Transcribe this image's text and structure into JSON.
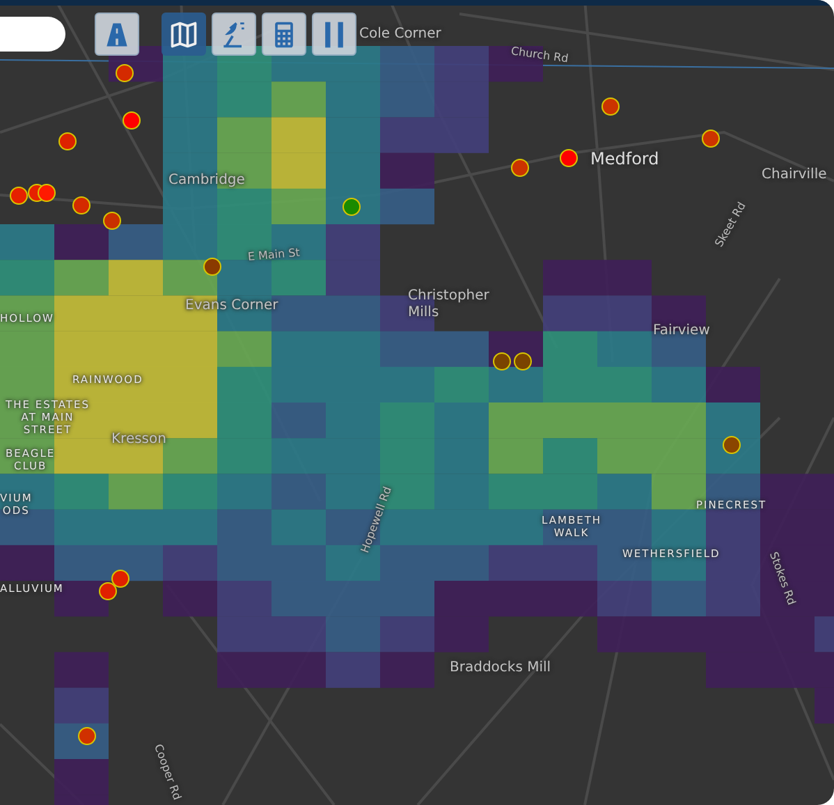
{
  "tools": [
    {
      "kind": "road",
      "selected": false
    },
    {
      "kind": "map",
      "selected": true
    },
    {
      "kind": "satellite",
      "selected": false
    },
    {
      "kind": "calculator",
      "selected": false
    },
    {
      "kind": "pause",
      "selected": false
    }
  ],
  "map_labels": [
    {
      "text": "Church Rd",
      "kind": "road"
    },
    {
      "text": "Cole Corner",
      "kind": "town"
    },
    {
      "text": "Medford",
      "kind": "city"
    },
    {
      "text": "Chairville",
      "kind": "town"
    },
    {
      "text": "Skeet Rd",
      "kind": "road"
    },
    {
      "text": "Cambridge",
      "kind": "town"
    },
    {
      "text": "E Main St",
      "kind": "road"
    },
    {
      "text": "Evans Corner",
      "kind": "town"
    },
    {
      "text": "Christopher\nMills",
      "kind": "town"
    },
    {
      "text": "Fairview",
      "kind": "town"
    },
    {
      "text": "HOLLOW",
      "kind": "district"
    },
    {
      "text": "RAINWOOD",
      "kind": "district"
    },
    {
      "text": "THE ESTATES\nAT MAIN\nSTREET",
      "kind": "district"
    },
    {
      "text": "Kresson",
      "kind": "town"
    },
    {
      "text": "BEAGLE\nCLUB",
      "kind": "district"
    },
    {
      "text": "VIUM\nODS",
      "kind": "district"
    },
    {
      "text": "LAMBETH\nWALK",
      "kind": "district"
    },
    {
      "text": "PINECREST",
      "kind": "district"
    },
    {
      "text": "WETHERSFIELD",
      "kind": "district"
    },
    {
      "text": "ALLUVIUM",
      "kind": "district"
    },
    {
      "text": "Hopewell Rd",
      "kind": "road"
    },
    {
      "text": "Stokes Rd",
      "kind": "road"
    },
    {
      "text": "Braddocks Mill",
      "kind": "town"
    },
    {
      "text": "Cooper Rd",
      "kind": "road"
    }
  ],
  "markers": [
    {
      "color": "#d42a00"
    },
    {
      "color": "#ff0000"
    },
    {
      "color": "#dd2200"
    },
    {
      "color": "#d42a00"
    },
    {
      "color": "#e62000"
    },
    {
      "color": "#e62000"
    },
    {
      "color": "#ff1a00"
    },
    {
      "color": "#c83000"
    },
    {
      "color": "#8a3a00"
    },
    {
      "color": "#1a8a00"
    },
    {
      "color": "#cc3300"
    },
    {
      "color": "#ff0000"
    },
    {
      "color": "#cc3300"
    },
    {
      "color": "#cc3300"
    },
    {
      "color": "#7a4400"
    },
    {
      "color": "#7a4400"
    },
    {
      "color": "#8a4500"
    },
    {
      "color": "#e02000"
    },
    {
      "color": "#e02000"
    },
    {
      "color": "#d03000"
    }
  ]
}
